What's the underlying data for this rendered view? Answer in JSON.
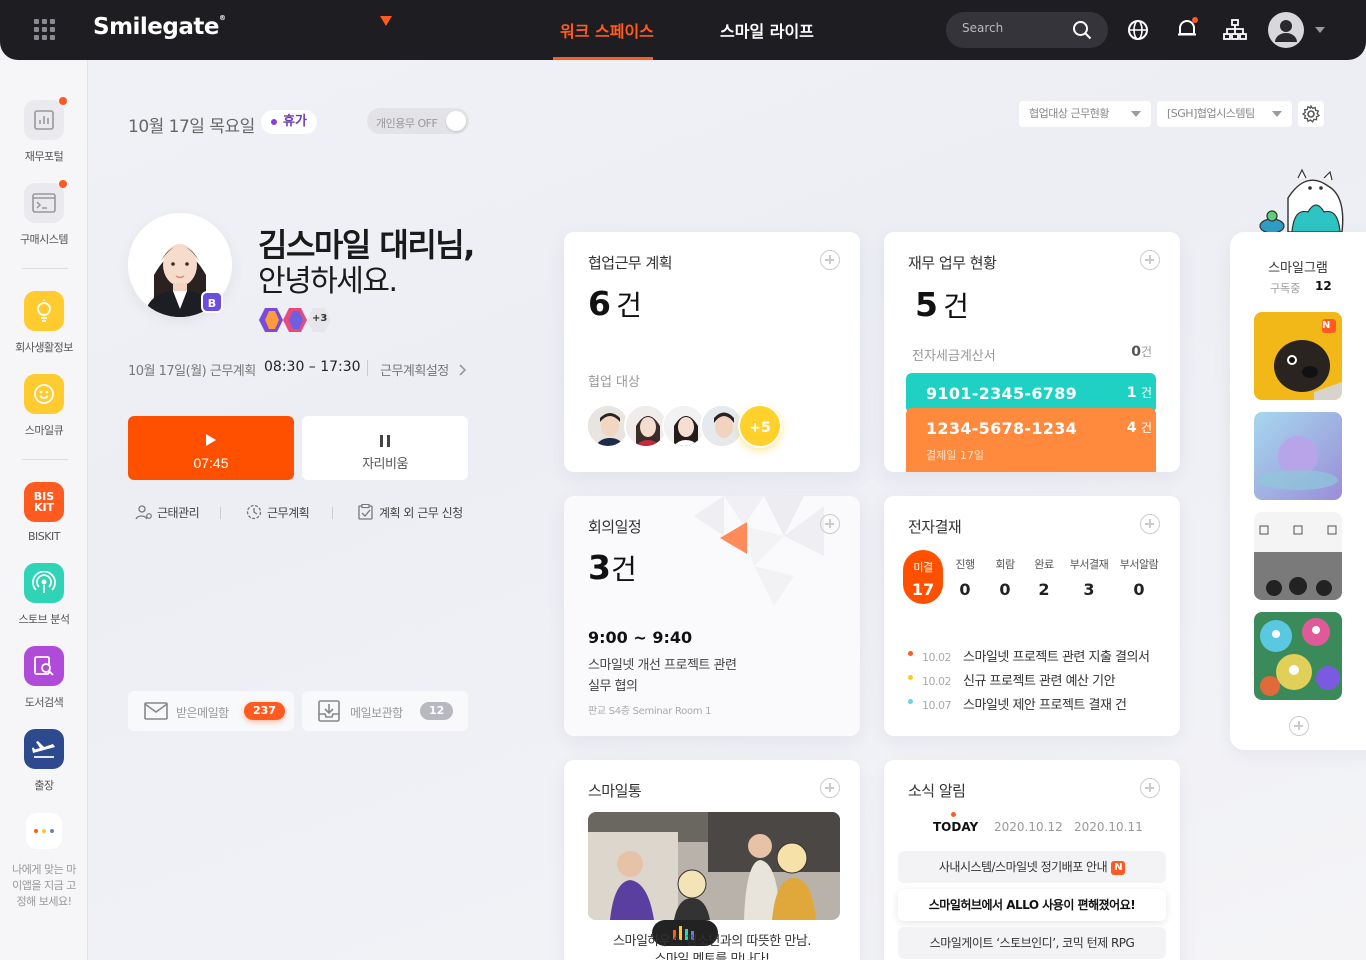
{
  "header": {
    "logo": "Smilegate",
    "logo_mark": "®",
    "tabs": [
      {
        "label": "워크 스페이스",
        "active": true
      },
      {
        "label": "스마일 라이프",
        "active": false
      }
    ],
    "search_placeholder": "Search",
    "accent_color": "#ff5a1f"
  },
  "sidebar": {
    "items": [
      {
        "label": "재무포털",
        "icon": "chart-icon",
        "new": true
      },
      {
        "label": "구매시스템",
        "icon": "terminal-icon",
        "new": true
      },
      {
        "label": "회사생활정보",
        "icon": "lightbulb-icon",
        "new": false
      },
      {
        "label": "스마일큐",
        "icon": "smile-icon",
        "new": false
      },
      {
        "label": "BISKIT",
        "icon": "biskit-icon",
        "icon_text": "BIS KIT",
        "new": false
      },
      {
        "label": "스토브 분석",
        "icon": "broadcast-icon",
        "new": false
      },
      {
        "label": "도서검색",
        "icon": "book-search-icon",
        "new": false
      },
      {
        "label": "출장",
        "icon": "plane-icon",
        "new": false
      }
    ],
    "note": "나에게 맞는 마이앱을 지금 고정해 보세요!"
  },
  "profile": {
    "date": "10월 17일 목요일",
    "status_badge": "휴가",
    "toggle_label": "개인용무 OFF",
    "name_line": "김스마일 대리님,",
    "greeting_line": "안녕하세요.",
    "level_badge": "B",
    "extra_badges": "+3",
    "schedule_label": "10월 17일(월) 근무계획",
    "schedule_time": "08:30 – 17:30",
    "schedule_setting": "근무계획설정",
    "start_button_time": "07:45",
    "away_button_label": "자리비움",
    "quick_links": [
      "근태관리",
      "근무계획",
      "계획 외 근무 신청"
    ],
    "mail": [
      {
        "label": "받은메일함",
        "count": "237"
      },
      {
        "label": "메일보관함",
        "count": "12"
      }
    ]
  },
  "cards": {
    "collab": {
      "title": "협업근무 계획",
      "count": "6",
      "unit": "건",
      "sub_label": "협업 대상",
      "more": "+5"
    },
    "finance": {
      "title": "재무 업무 현황",
      "count": "5",
      "unit": "건",
      "tax_label": "전자세금계산서",
      "tax_count": "0",
      "tax_unit": "건",
      "accounts": [
        {
          "account": "9101-2345-6789",
          "count": "1",
          "unit": "건",
          "color": "#1ed1c2"
        },
        {
          "account": "1234-5678-1234",
          "count": "4",
          "unit": "건",
          "note": "결제일 17일",
          "color": "#ff8a3d"
        }
      ]
    },
    "meeting": {
      "title": "회의일정",
      "count": "3",
      "unit": "건",
      "time": "9:00 ~ 9:40",
      "subject_line1": "스마일넷 개선 프로젝트 관련",
      "subject_line2": "실무 협의",
      "room": "판교 S4층 Seminar Room 1"
    },
    "approval": {
      "title": "전자결재",
      "stats": [
        {
          "label": "미결",
          "value": "17",
          "active": true
        },
        {
          "label": "진행",
          "value": "0"
        },
        {
          "label": "회람",
          "value": "0"
        },
        {
          "label": "완료",
          "value": "2"
        },
        {
          "label": "부서결재",
          "value": "3"
        },
        {
          "label": "부서알람",
          "value": "0"
        }
      ],
      "items": [
        {
          "date": "10.02",
          "text": "스마일넷 프로젝트 관련 지출 결의서",
          "color": "#ff5a1f"
        },
        {
          "date": "10.02",
          "text": "신규 프로젝트 관련 예산 기안",
          "color": "#ffc928"
        },
        {
          "date": "10.07",
          "text": "스마일넷 제안 프로젝트 결재 건",
          "color": "#6ad3ea"
        }
      ]
    },
    "smiletong": {
      "title": "스마일통",
      "caption_line1": "스마일하우스 청소년과의 따뜻한 만남.",
      "caption_line2": "스마일 멘토를 만나다!"
    },
    "news": {
      "title": "소식 알림",
      "tabs": [
        "TODAY",
        "2020.10.12",
        "2020.10.11"
      ],
      "items": [
        {
          "text": "사내시스템/스마일넷 정기배포 안내",
          "badge": "N",
          "highlight": false
        },
        {
          "text": "스마일허브에서 ALLO 사용이 편해졌어요!",
          "highlight": true
        },
        {
          "text": "스마일게이트 ‘스토브인디’, 코믹 턴제 RPG",
          "highlight": false
        }
      ]
    }
  },
  "filters": {
    "dropdown1": "협업대상 근무현황",
    "dropdown2": "[SGH]협업시스템팀"
  },
  "smilegram": {
    "title": "스마일그램",
    "sub_label": "구독중",
    "sub_count": "12",
    "thumb_badge": "N"
  }
}
